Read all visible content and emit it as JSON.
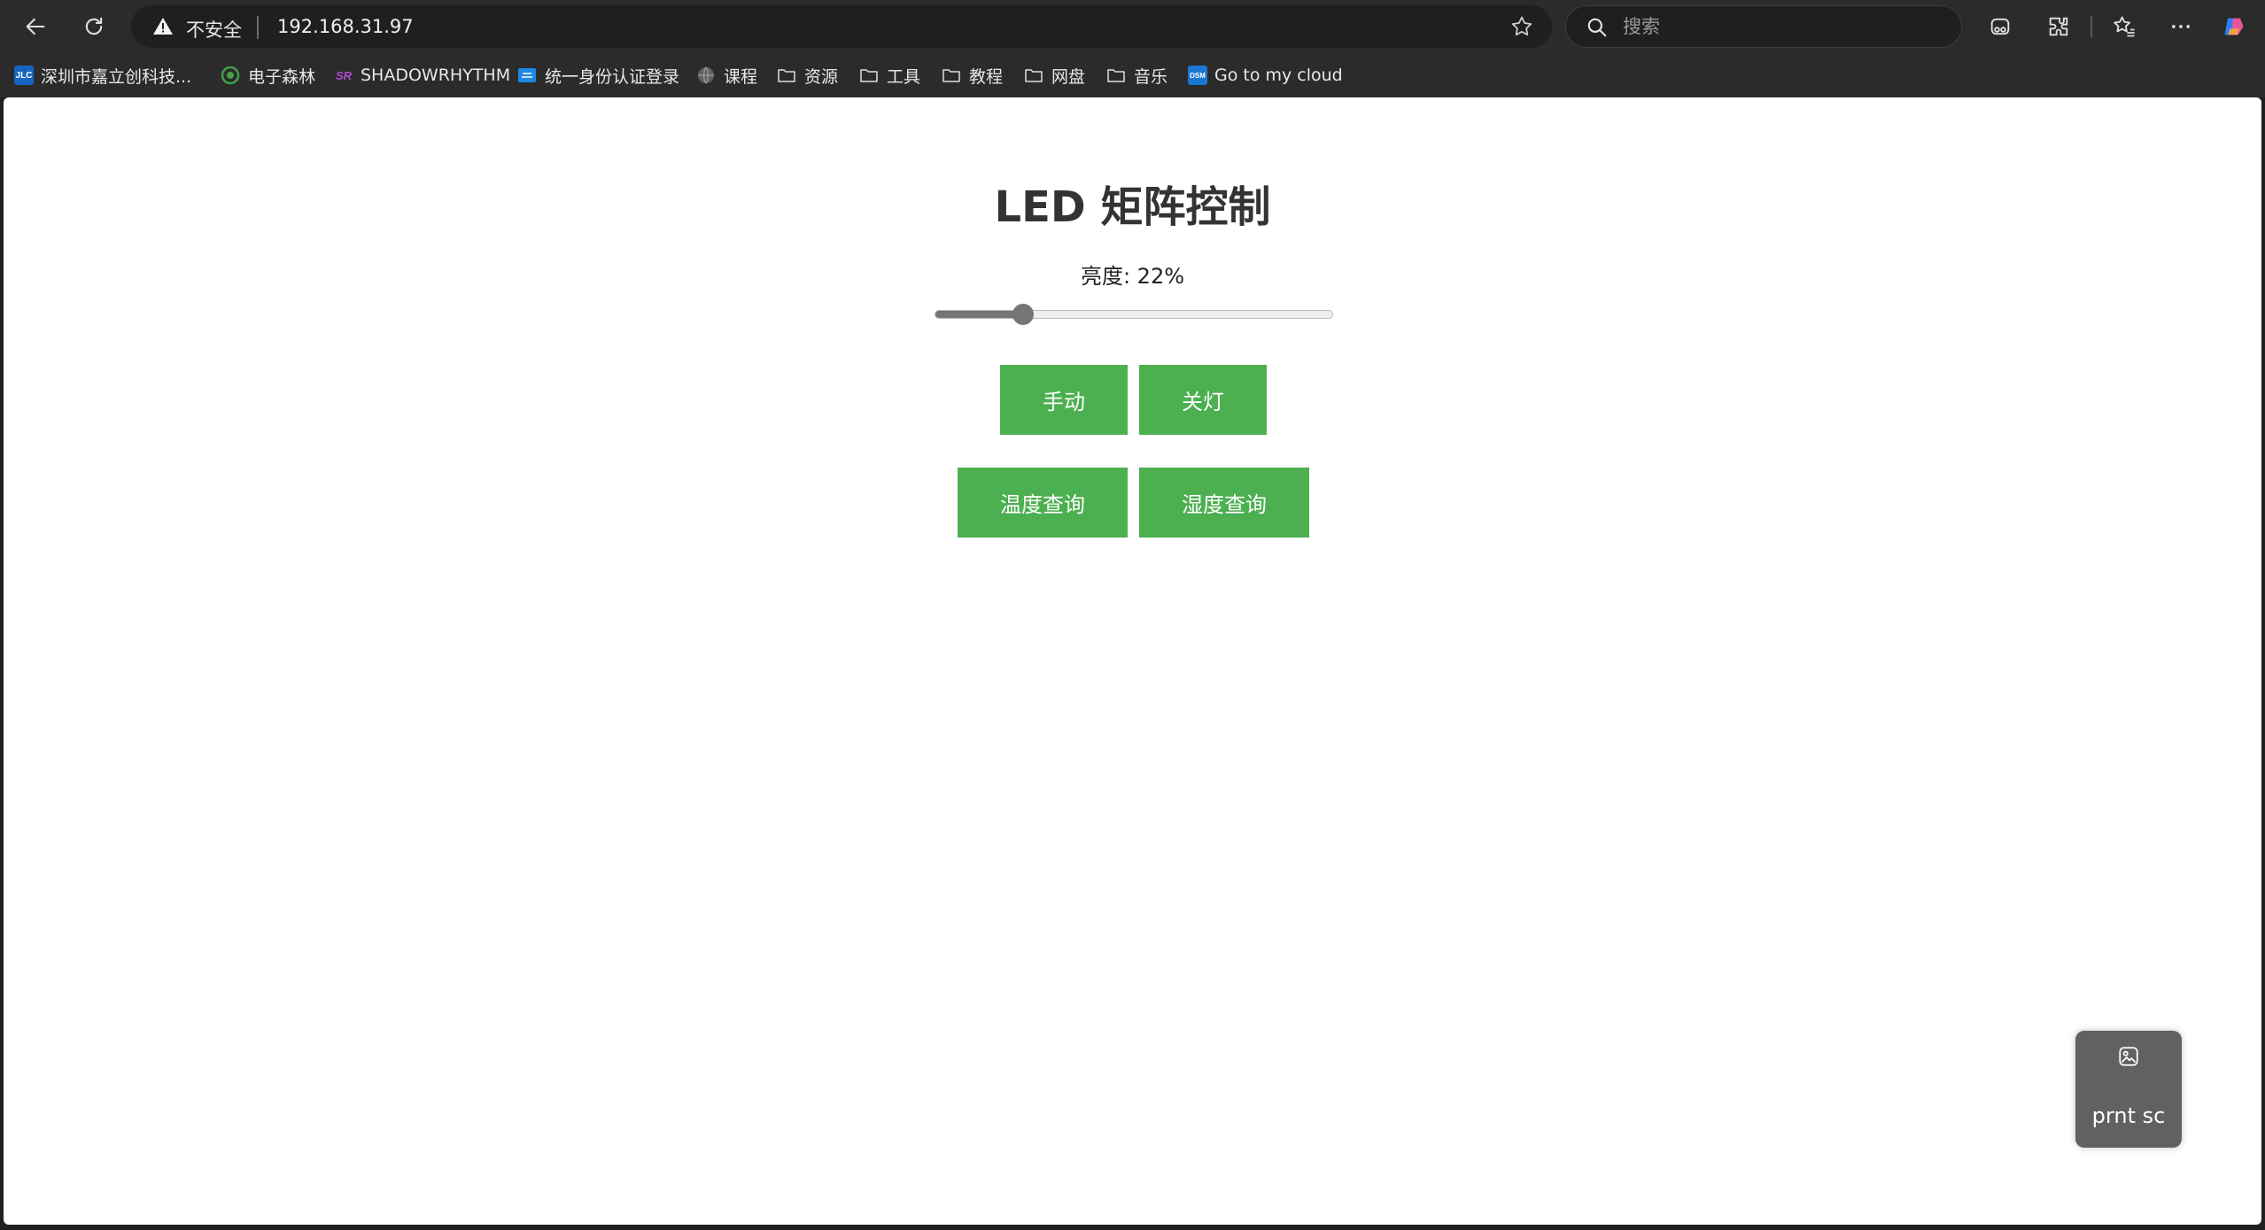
{
  "browser": {
    "insecure_label": "不安全",
    "url": "192.168.31.97",
    "search_placeholder": "搜索"
  },
  "bookmarks": [
    {
      "label": "深圳市嘉立创科技...",
      "favicon_text": "JLC",
      "favicon_color": "#1565c0"
    },
    {
      "label": "电子森林",
      "favicon_color": "#43a047"
    },
    {
      "label": "SHADOWRHYTHM",
      "favicon_text": "SR",
      "favicon_color": "#9c27b0"
    },
    {
      "label": "统一身份认证登录",
      "favicon_color": "#1e88e5"
    },
    {
      "label": "课程",
      "favicon_color": "#757575"
    },
    {
      "label": "资源"
    },
    {
      "label": "工具"
    },
    {
      "label": "教程"
    },
    {
      "label": "网盘"
    },
    {
      "label": "音乐"
    },
    {
      "label": "Go to my cloud",
      "favicon_text": "DSM",
      "favicon_color": "#1976d2"
    }
  ],
  "page": {
    "title": "LED 矩阵控制",
    "brightness_label": "亮度: 22%",
    "brightness": 22,
    "buttons": {
      "manual": "手动",
      "lights_off": "关灯",
      "temperature": "温度查询",
      "humidity": "湿度查询"
    },
    "button_color": "#4caf50"
  },
  "capture_widget": {
    "label": "prnt sc",
    "icon": "image-icon"
  }
}
